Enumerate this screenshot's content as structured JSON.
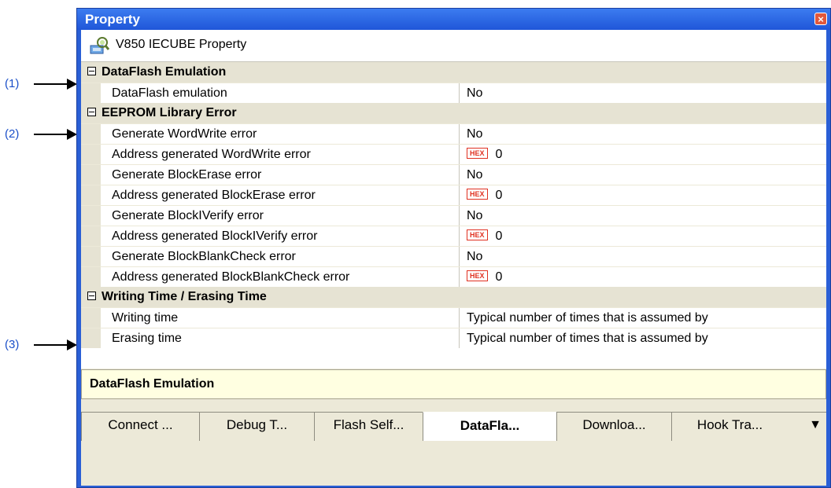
{
  "callouts": [
    "(1)",
    "(2)",
    "(3)"
  ],
  "window": {
    "title": "Property",
    "close_glyph": "×",
    "object_name": "V850 IECUBE Property",
    "object_icon": "property-icon"
  },
  "grid": {
    "rows": [
      {
        "type": "category",
        "label": "DataFlash Emulation"
      },
      {
        "type": "prop",
        "name": "DataFlash emulation",
        "value": "No"
      },
      {
        "type": "category",
        "label": "EEPROM Library Error"
      },
      {
        "type": "prop",
        "name": "Generate WordWrite error",
        "value": "No"
      },
      {
        "type": "prop",
        "name": "Address generated WordWrite error",
        "hex": "HEX",
        "value": "0"
      },
      {
        "type": "prop",
        "name": "Generate BlockErase error",
        "value": "No"
      },
      {
        "type": "prop",
        "name": "Address generated BlockErase error",
        "hex": "HEX",
        "value": "0"
      },
      {
        "type": "prop",
        "name": "Generate BlockIVerify error",
        "value": "No"
      },
      {
        "type": "prop",
        "name": "Address generated BlockIVerify error",
        "hex": "HEX",
        "value": "0"
      },
      {
        "type": "prop",
        "name": "Generate BlockBlankCheck error",
        "value": "No"
      },
      {
        "type": "prop",
        "name": "Address generated BlockBlankCheck error",
        "hex": "HEX",
        "value": "0"
      },
      {
        "type": "category",
        "label": "Writing Time / Erasing Time"
      },
      {
        "type": "prop",
        "name": "Writing time",
        "value": "Typical number of times that is assumed by"
      },
      {
        "type": "prop",
        "name": "Erasing time",
        "value": "Typical number of times that is assumed by"
      }
    ]
  },
  "description": "DataFlash Emulation",
  "tabs": [
    {
      "label": "Connect ...",
      "active": false
    },
    {
      "label": "Debug T...",
      "active": false
    },
    {
      "label": "Flash Self...",
      "active": false
    },
    {
      "label": "DataFla...",
      "active": true
    },
    {
      "label": "Downloa...",
      "active": false
    },
    {
      "label": "Hook Tra...",
      "active": false
    }
  ],
  "tab_menu_glyph": "▼"
}
